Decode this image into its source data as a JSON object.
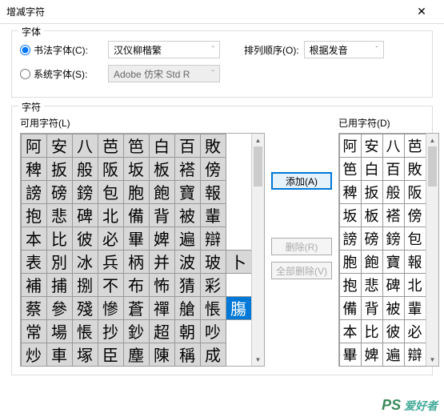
{
  "window": {
    "title": "增减字符"
  },
  "fontGroup": {
    "label": "字体",
    "calligRadio": "书法字体(C):",
    "systemRadio": "系统字体(S):",
    "calligFont": "汉仪柳楷繁",
    "systemFont": "Adobe 仿宋 Std R",
    "sortLabel": "排列顺序(O):",
    "sortValue": "根据发音"
  },
  "charGroup": {
    "label": "字符",
    "availLabel": "可用字符(L)",
    "usedLabel": "已用字符(D)",
    "addBtn": "添加(A)",
    "delBtn": "删除(R)",
    "delAllBtn": "全部删除(V)"
  },
  "avail": [
    [
      "阿",
      "安",
      "八",
      "芭",
      "笆",
      "白",
      "百",
      "敗"
    ],
    [
      "稗",
      "扳",
      "般",
      "阪",
      "坂",
      "板",
      "褡",
      "傍"
    ],
    [
      "謗",
      "磅",
      "鎊",
      "包",
      "胞",
      "飽",
      "寶",
      "報"
    ],
    [
      "抱",
      "悲",
      "碑",
      "北",
      "備",
      "背",
      "被",
      "輩"
    ],
    [
      "本",
      "比",
      "彼",
      "必",
      "畢",
      "婢",
      "遍",
      "辯"
    ],
    [
      "表",
      "別",
      "冰",
      "兵",
      "柄",
      "并",
      "波",
      "玻",
      "卜"
    ],
    [
      "補",
      "捕",
      "捌",
      "不",
      "布",
      "怖",
      "猜",
      "彩"
    ],
    [
      "蔡",
      "參",
      "殘",
      "慘",
      "蒼",
      "禪",
      "艙",
      "悵",
      "膓"
    ],
    [
      "常",
      "場",
      "悵",
      "抄",
      "鈔",
      "超",
      "朝",
      "吵"
    ],
    [
      "炒",
      "車",
      "塚",
      "臣",
      "塵",
      "陳",
      "稱",
      "成"
    ]
  ],
  "selectedCell": {
    "row": 7,
    "col": 8
  },
  "used": [
    [
      "阿",
      "安",
      "八",
      "芭"
    ],
    [
      "笆",
      "白",
      "百",
      "敗"
    ],
    [
      "稗",
      "扳",
      "般",
      "阪"
    ],
    [
      "坂",
      "板",
      "褡",
      "傍"
    ],
    [
      "謗",
      "磅",
      "鎊",
      "包"
    ],
    [
      "胞",
      "飽",
      "寶",
      "報"
    ],
    [
      "抱",
      "悲",
      "碑",
      "北"
    ],
    [
      "備",
      "背",
      "被",
      "輩"
    ],
    [
      "本",
      "比",
      "彼",
      "必"
    ],
    [
      "畢",
      "婢",
      "遍",
      "辯"
    ]
  ],
  "watermark": {
    "ps": "PS",
    "text": "爱好者"
  }
}
